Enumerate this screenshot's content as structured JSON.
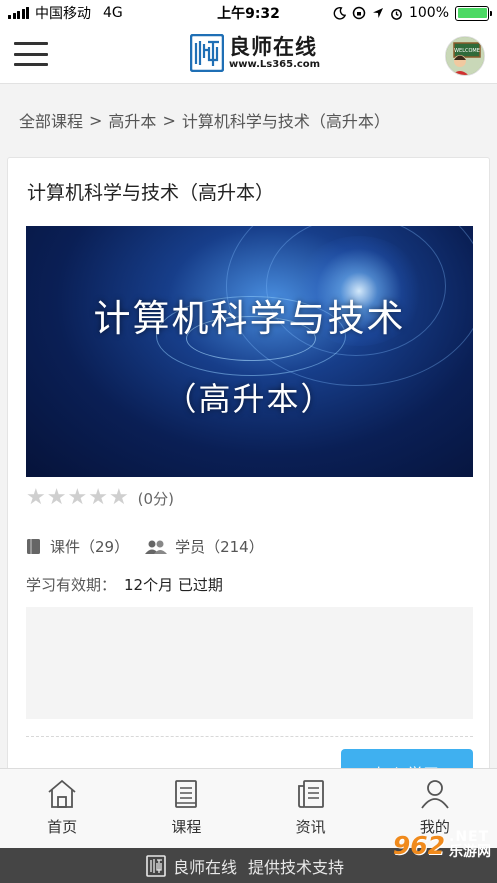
{
  "status_bar": {
    "carrier": "中国移动",
    "network": "4G",
    "time": "上午9:32",
    "battery": "100%"
  },
  "header": {
    "logo_name": "良师在线",
    "logo_url": "www.Ls365.com",
    "avatar_text": "WELCOME"
  },
  "breadcrumb": {
    "items": [
      "全部课程",
      "高升本",
      "计算机科学与技术（高升本）"
    ],
    "separator": ">"
  },
  "course": {
    "title": "计算机科学与技术（高升本）",
    "cover_title": "计算机科学与技术",
    "cover_subtitle": "（高升本）",
    "rating_stars": 0,
    "rating_max": 5,
    "rating_label": "(0分)",
    "courseware_label": "课件（29）",
    "students_label": "学员（214）",
    "validity_label": "学习有效期：",
    "validity_value": "12个月 已过期",
    "join_button": "加入学习",
    "accent_color": "#3fb0f0"
  },
  "tabbar": {
    "items": [
      {
        "label": "首页",
        "icon": "home-icon"
      },
      {
        "label": "课程",
        "icon": "book-icon"
      },
      {
        "label": "资讯",
        "icon": "news-icon"
      },
      {
        "label": "我的",
        "icon": "user-icon"
      }
    ]
  },
  "footer": {
    "text": "良师在线",
    "suffix": "提供技术支持"
  },
  "watermark": {
    "number": "962",
    "suffix": ".NET",
    "name": "乐游网"
  }
}
